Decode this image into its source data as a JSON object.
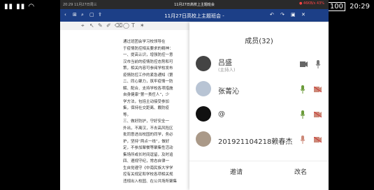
{
  "status_bar": {
    "left_icons": "signal wifi",
    "right_time": "20:29",
    "battery": "100",
    "right_icons": "⊕ 🔇 ⏰ ✻ ◎ ✈"
  },
  "phone_top": {
    "left": "20:29 11月27日周三",
    "center": "11月27日高校上主题班会",
    "right": "● 46KB/s 43%"
  },
  "nav": {
    "title": "11月27日高校上主题班会 -"
  },
  "doc": {
    "lines": [
      "通过班团会学习校领导在",
      "于疫情防控相关要求的精神：",
      "一、提高认识，增强防控一意",
      "汉市当前的疫情防控态势和可",
      "策，相关内容可参阅学校发布",
      "疫情防控工作的紧急通知（第",
      "二、同心聚力，筑牢疫情一防",
      "解、配合、支持学校各项措施",
      "自身健康“第一责任人”，少",
      "学方法，包括主动接受参加",
      "集，保持社交距离、戴防疫",
      "等。",
      "三、做好防护，守好安全一",
      "外出，不离汉，不去高风险区",
      "批同意进出校园的同学，务必",
      "护，坚持“两点一线”，做好",
      "定，不参加聚餐等聚集性活动",
      "集场所或长时间逗留，及时追",
      "四、遵规守纪，常态自律一",
      "生自觉遵守《中南民族大学学",
      "控有关规定和学校各项相关规",
      "违规出入校园、在公共场所聚集"
    ]
  },
  "panel": {
    "title": "成员(32)",
    "members": [
      {
        "name": "吕盛",
        "sub": "(主持人)"
      },
      {
        "name": "张菁沁",
        "sub": ""
      },
      {
        "name": "@",
        "sub": ""
      },
      {
        "name": "201921104218赖春杰",
        "sub": ""
      }
    ],
    "invite": "邀请",
    "rename": "改名"
  }
}
